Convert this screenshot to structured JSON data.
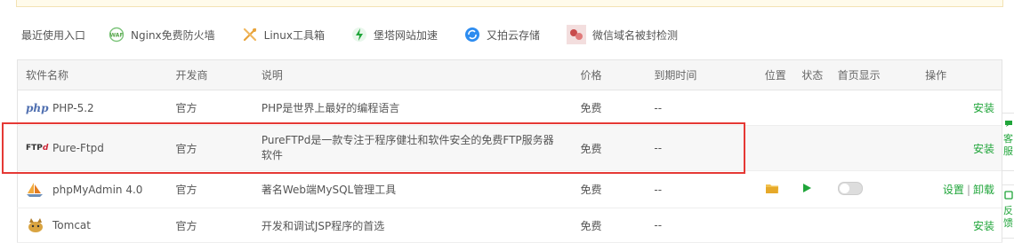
{
  "recent": {
    "label": "最近使用入口",
    "items": [
      {
        "label": "Nginx免费防火墙",
        "icon": "waf-shield-icon"
      },
      {
        "label": "Linux工具箱",
        "icon": "tools-icon"
      },
      {
        "label": "堡塔网站加速",
        "icon": "lightning-icon"
      },
      {
        "label": "又拍云存储",
        "icon": "cloud-sync-icon"
      },
      {
        "label": "微信域名被封检测",
        "icon": "wechat-check-icon"
      }
    ]
  },
  "table": {
    "headers": {
      "name": "软件名称",
      "vendor": "开发商",
      "desc": "说明",
      "price": "价格",
      "expire": "到期时间",
      "pos": "位置",
      "status": "状态",
      "home": "首页显示",
      "ops": "操作"
    },
    "rows": [
      {
        "name": "PHP-5.2",
        "icon_text": "php",
        "vendor": "官方",
        "desc": "PHP是世界上最好的编程语言",
        "price": "免费",
        "expire": "--",
        "ops": [
          "安装"
        ]
      },
      {
        "name": "Pure-Ftpd",
        "icon_text": "FTP",
        "icon_suffix": "d",
        "vendor": "官方",
        "desc": "PureFTPd是一款专注于程序健壮和软件安全的免费FTP服务器软件",
        "price": "免费",
        "expire": "--",
        "ops": [
          "安装"
        ]
      },
      {
        "name": "phpMyAdmin 4.0",
        "vendor": "官方",
        "desc": "著名Web端MySQL管理工具",
        "price": "免费",
        "expire": "--",
        "ops": [
          "设置",
          "卸载"
        ],
        "home_on": false
      },
      {
        "name": "Tomcat",
        "vendor": "官方",
        "desc": "开发和调试JSP程序的首选",
        "price": "免费",
        "expire": "--",
        "ops": [
          "安装"
        ]
      }
    ]
  },
  "side_tabs": [
    {
      "text": "客服"
    },
    {
      "text": "反馈"
    }
  ],
  "colors": {
    "accent": "#20a53a",
    "highlight": "#e53935",
    "header_bg": "#f6f6f6"
  }
}
